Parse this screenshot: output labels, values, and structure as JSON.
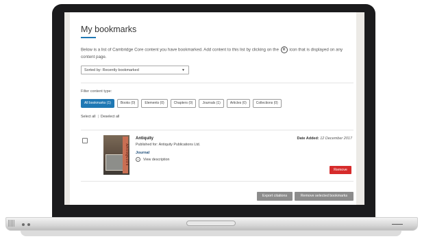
{
  "page": {
    "title": "My bookmarks",
    "intro_part1": "Below is a list of Cambridge Core content you have bookmarked. Add content to this list by clicking on the ",
    "intro_icon_glyph": "R",
    "intro_part2": " icon that is displayed on any content page.",
    "sort": {
      "selected": "Sorted by: Recently bookmarked"
    }
  },
  "filters": {
    "label": "Filter content type:",
    "buttons": [
      {
        "label": "All bookmarks (1)",
        "active": true
      },
      {
        "label": "Books (0)"
      },
      {
        "label": "Elements (0)"
      },
      {
        "label": "Chapters (0)"
      },
      {
        "label": "Journals (1)"
      },
      {
        "label": "Articles (0)"
      },
      {
        "label": "Collections (0)"
      }
    ],
    "select_all": "Select all",
    "deselect_all": "Deselect all"
  },
  "bookmark": {
    "cover_text": "ANTIQUITY",
    "title": "Antiquity",
    "published_for": "Published for: Antiquity Publications Ltd.",
    "type": "Journal",
    "view_description": "View description",
    "date_label": "Date Added:",
    "date_value": "12 December 2017",
    "remove_label": "Remove"
  },
  "actions": {
    "export_label": "Export citations",
    "remove_selected_label": "Remove selected bookmarks"
  },
  "colors": {
    "accent": "#1f78b4",
    "danger": "#d62b2b",
    "neutral_button": "#8c8c8c",
    "bezel": "#1b1b1d"
  }
}
